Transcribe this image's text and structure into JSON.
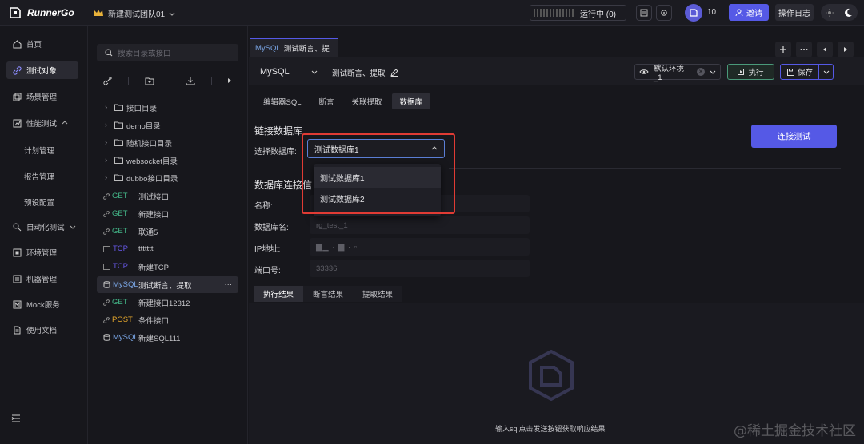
{
  "app": {
    "logo_text": "RunnerGo",
    "team_name": "新建测试团队01",
    "running_label": "运行中 (0)",
    "member_count": "10",
    "invite_label": "邀请",
    "op_log_label": "操作日志"
  },
  "nav": {
    "items": [
      {
        "label": "首页",
        "icon": "home-icon"
      },
      {
        "label": "测试对象",
        "icon": "link-icon"
      },
      {
        "label": "场景管理",
        "icon": "scene-icon"
      },
      {
        "label": "性能测试",
        "icon": "chart-icon"
      },
      {
        "label": "计划管理"
      },
      {
        "label": "报告管理"
      },
      {
        "label": "预设配置"
      },
      {
        "label": "自动化测试",
        "icon": "auto-icon"
      },
      {
        "label": "环境管理",
        "icon": "env-icon"
      },
      {
        "label": "机器管理",
        "icon": "machine-icon"
      },
      {
        "label": "Mock服务",
        "icon": "mock-icon"
      },
      {
        "label": "使用文档",
        "icon": "doc-icon"
      }
    ]
  },
  "tree": {
    "search_placeholder": "搜索目录或接口",
    "folders": [
      "接口目录",
      "demo目录",
      "随机接口目录",
      "websocket目录",
      "dubbo接口目录"
    ],
    "apis": [
      {
        "method": "GET",
        "name": "测试接口"
      },
      {
        "method": "GET",
        "name": "新建接口"
      },
      {
        "method": "GET",
        "name": "联通5"
      },
      {
        "method": "TCP",
        "name": "ttttttt"
      },
      {
        "method": "TCP",
        "name": "新建TCP"
      },
      {
        "method": "MySQL",
        "name": "测试断言、提取",
        "more": "···"
      },
      {
        "method": "GET",
        "name": "新建接口12312"
      },
      {
        "method": "POST",
        "name": "条件接口"
      },
      {
        "method": "MySQL",
        "name": "新建SQL111"
      }
    ]
  },
  "main": {
    "tab": {
      "prefix": "MySQL",
      "title": "测试断言、提"
    },
    "db_type": "MySQL",
    "request_name": "测试断言、提取",
    "env_label": "默认环境_1",
    "exec_label": "执行",
    "save_label": "保存",
    "subtabs": [
      "编辑器SQL",
      "断言",
      "关联提取",
      "数据库"
    ],
    "connect_section_title": "链接数据库",
    "choose_db_label": "选择数据库:",
    "choose_db_value": "测试数据库1",
    "db_options": [
      "测试数据库1",
      "测试数据库2"
    ],
    "connect_test_label": "连接测试",
    "info_section_title": "数据库连接信",
    "fields": [
      {
        "label": "名称:",
        "value": ""
      },
      {
        "label": "数据库名:",
        "value": "rg_test_1"
      },
      {
        "label": "IP地址:",
        "value": "▆▁  ·  ▆  ·  ▫"
      },
      {
        "label": "端口号:",
        "value": "33336"
      }
    ],
    "result_tabs": [
      "执行结果",
      "断言结果",
      "提取结果"
    ],
    "empty_hint": "输入sql点击发送按钮获取响应结果"
  },
  "watermark": "@稀土掘金技术社区"
}
